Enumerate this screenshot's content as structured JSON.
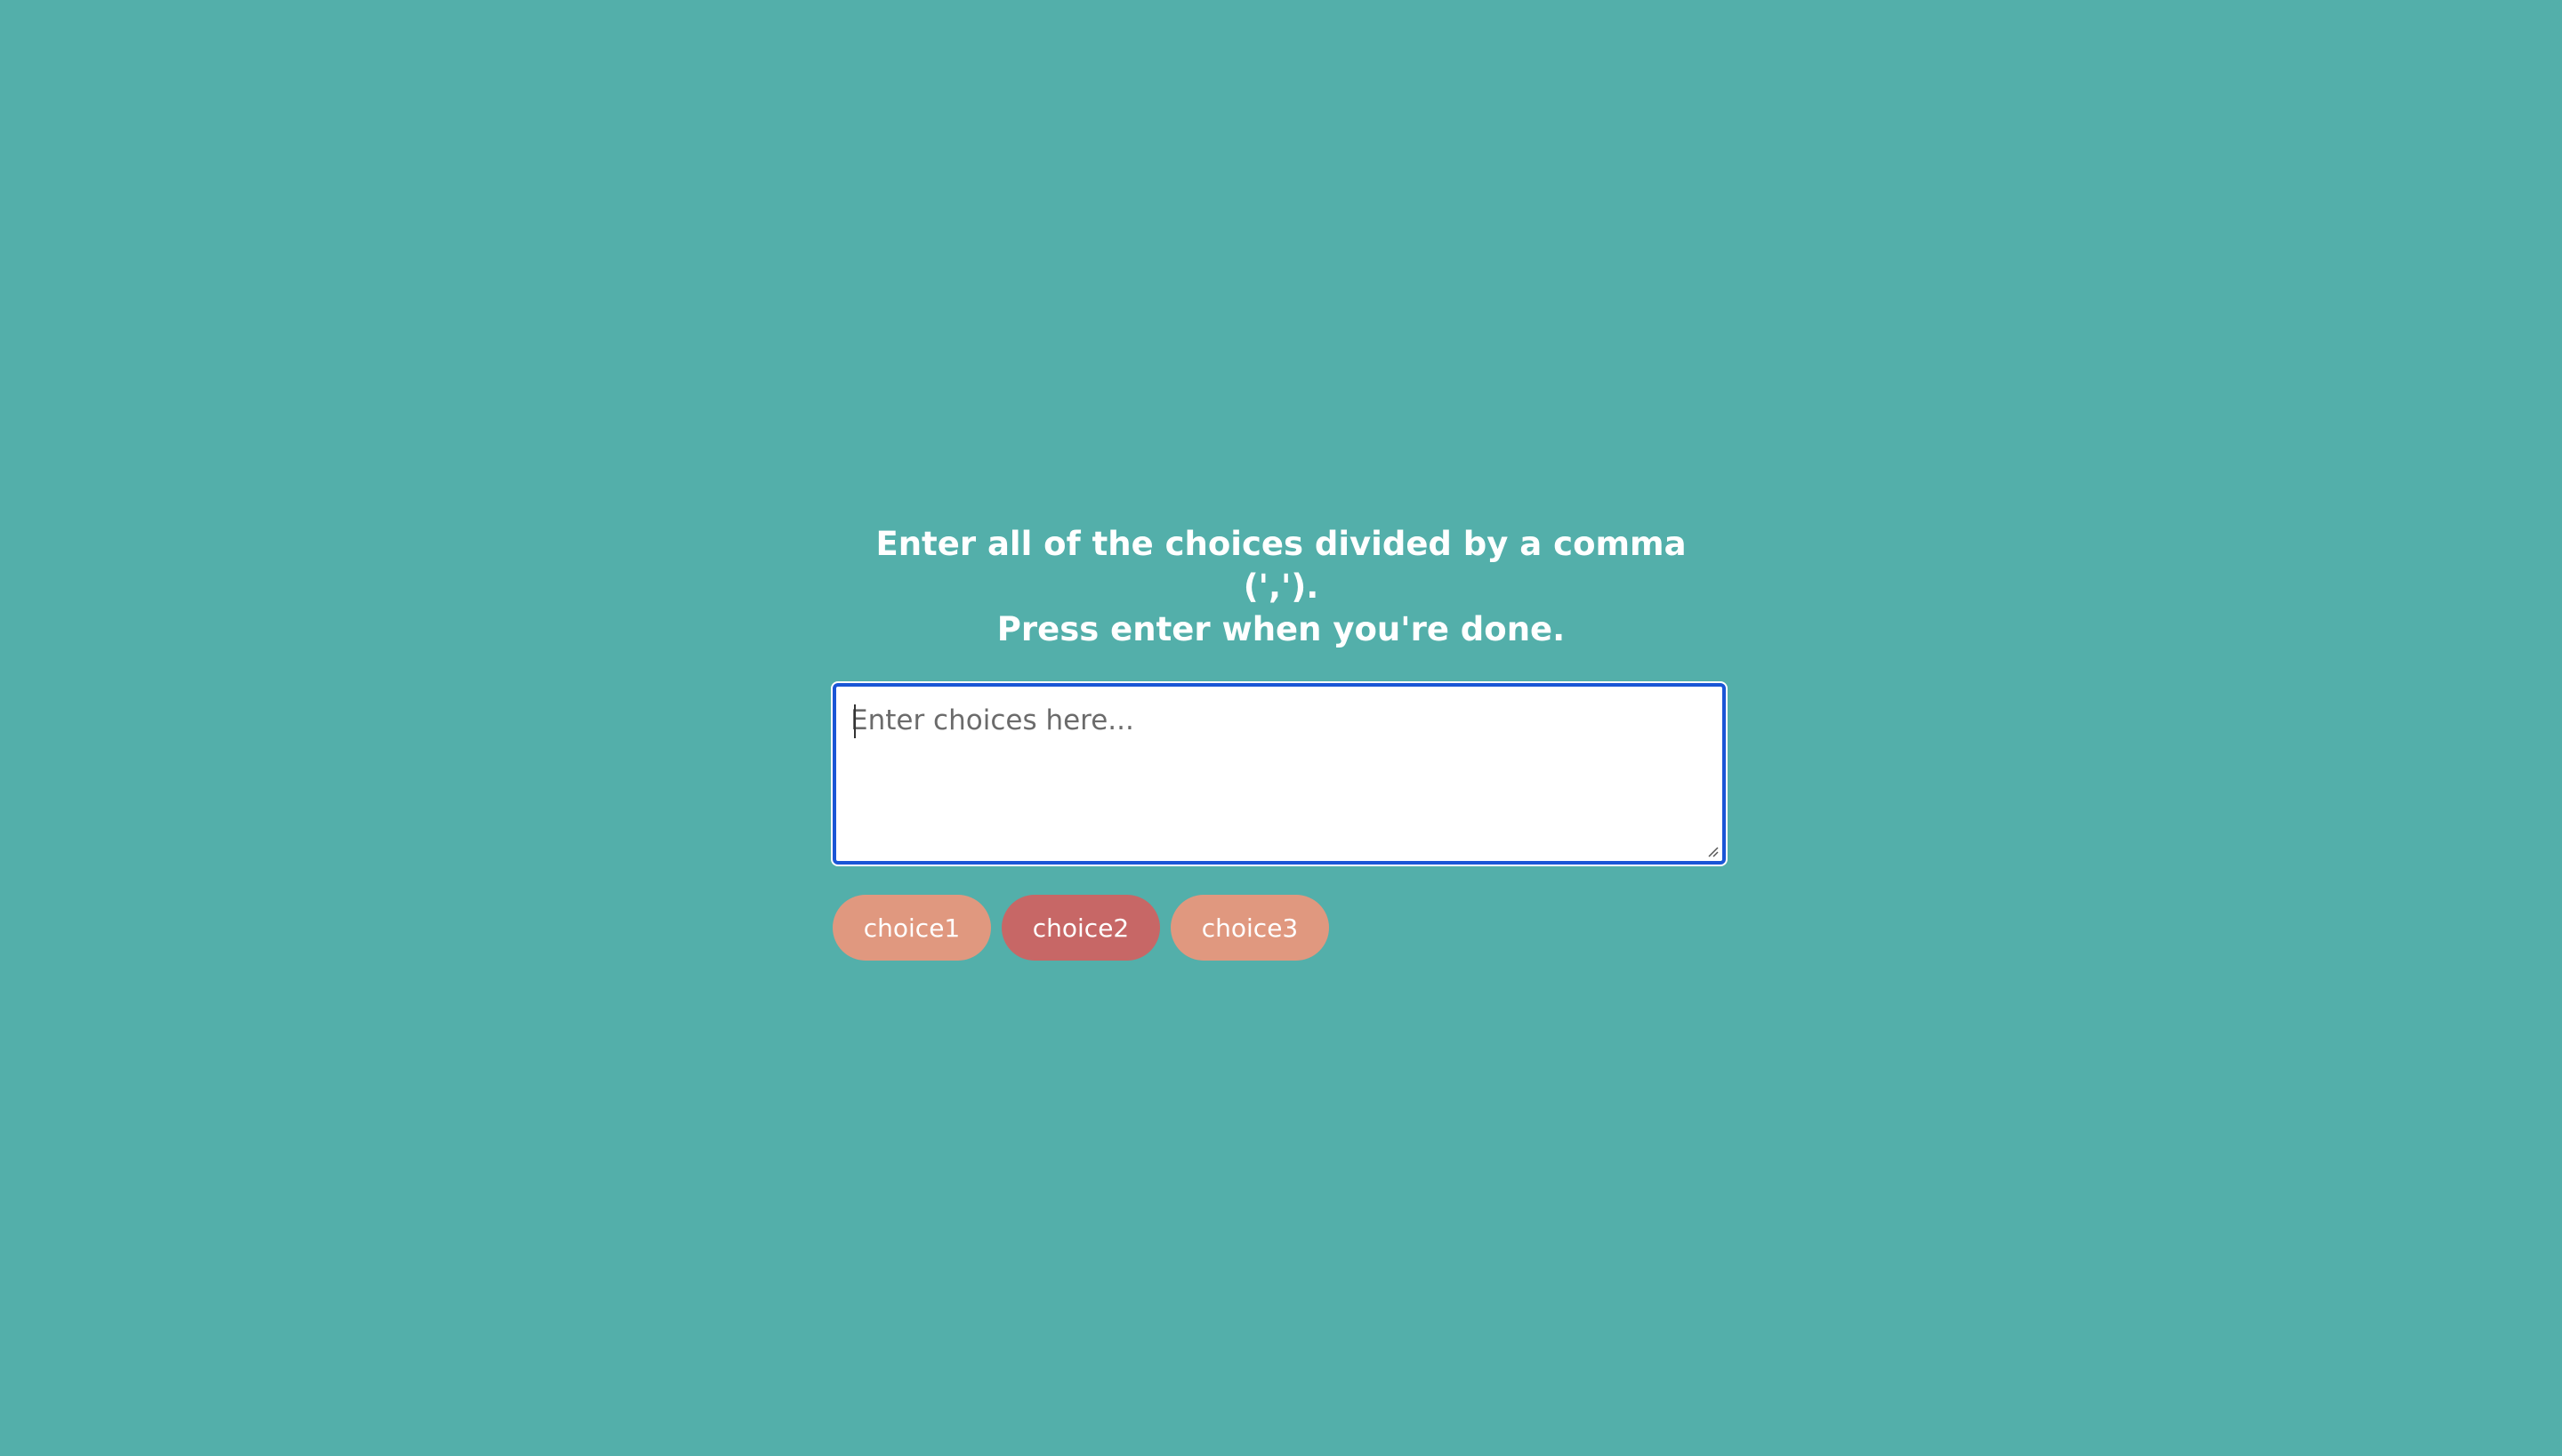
{
  "instructions": {
    "line1": "Enter all of the choices divided by a comma (',').",
    "line2": "Press enter when you're done."
  },
  "input": {
    "placeholder": "Enter choices here...",
    "value": ""
  },
  "choices": [
    {
      "label": "choice1",
      "color": "#e0987f",
      "highlighted": false
    },
    {
      "label": "choice2",
      "color": "#c76766",
      "highlighted": true
    },
    {
      "label": "choice3",
      "color": "#e0987f",
      "highlighted": false
    }
  ],
  "colors": {
    "background": "#53afaa",
    "focus_border": "#1a56d6",
    "choice_default": "#e0987f",
    "choice_highlighted": "#c76766"
  }
}
